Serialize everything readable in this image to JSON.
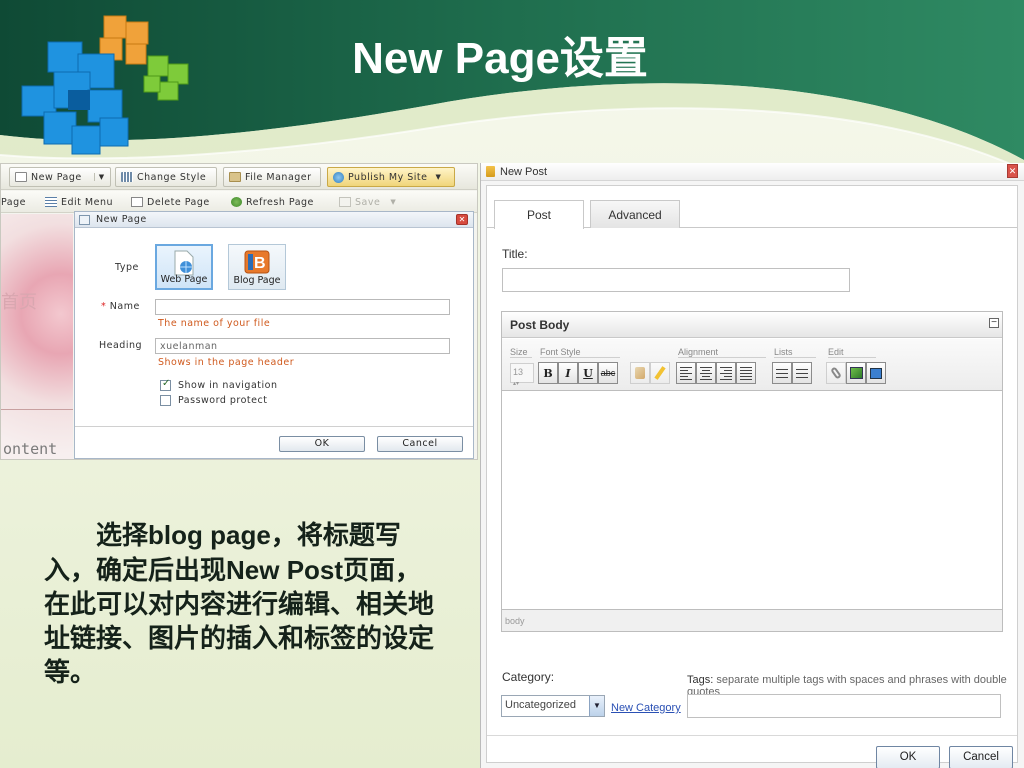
{
  "slide": {
    "title": "New Page设置",
    "caption": {
      "indent": "　　",
      "p1": "选择",
      "b1": "blog page",
      "p2": "，将标题写入，确定后出现",
      "b2": "New Post",
      "p3": "页面，在此可以对内容进行编辑、相关地址链接、图片的插入和标签的设定等。"
    }
  },
  "left_shot": {
    "toolbar1": {
      "new_page": "New Page",
      "change_style": "Change Style",
      "file_manager": "File Manager",
      "publish": "Publish My Site"
    },
    "toolbar2": {
      "page_frag": "Page",
      "edit_menu": "Edit Menu",
      "delete_page": "Delete Page",
      "refresh_page": "Refresh Page",
      "save": "Save"
    },
    "bg_text": "ontent",
    "bg_cn": "首页",
    "dialog": {
      "title": "New Page",
      "type_label": "Type",
      "web_page": "Web Page",
      "blog_page": "Blog Page",
      "name_label": "Name",
      "required_mark": "*",
      "name_value": "",
      "name_hint": "The name of your file",
      "heading_label": "Heading",
      "heading_value": "xuelanman",
      "heading_hint": "Shows in the page header",
      "show_nav": "Show in navigation",
      "show_nav_checked": true,
      "password": "Password protect",
      "password_checked": false,
      "ok": "OK",
      "cancel": "Cancel"
    }
  },
  "right_shot": {
    "window_title": "New Post",
    "tabs": [
      "Post",
      "Advanced"
    ],
    "active_tab": "Post",
    "title_label": "Title:",
    "title_value": "",
    "post_body": "Post Body",
    "toolbar_groups": {
      "size": "Size",
      "font_style": "Font Style",
      "alignment": "Alignment",
      "lists": "Lists",
      "edit": "Edit"
    },
    "size_value": "13",
    "bold": "B",
    "italic": "I",
    "underline": "U",
    "strike": "abc",
    "status_path": "body",
    "category_label": "Category:",
    "category_value": "Uncategorized",
    "new_category": "New Category",
    "tags_label": "Tags:",
    "tags_hint": " separate multiple tags with spaces and phrases with double quotes",
    "ok": "OK",
    "cancel": "Cancel"
  }
}
